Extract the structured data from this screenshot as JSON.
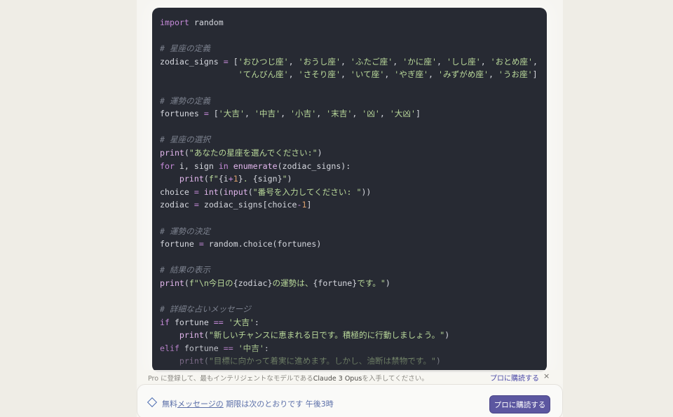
{
  "code_lines": [
    [
      {
        "t": "import",
        "c": "kw"
      },
      {
        "t": " random",
        "c": ""
      }
    ],
    [],
    [
      {
        "t": "# 星座の定義",
        "c": "cmt"
      }
    ],
    [
      {
        "t": "zodiac_signs ",
        "c": ""
      },
      {
        "t": "=",
        "c": "op"
      },
      {
        "t": " [",
        "c": ""
      },
      {
        "t": "'おひつじ座'",
        "c": "str"
      },
      {
        "t": ", ",
        "c": ""
      },
      {
        "t": "'おうし座'",
        "c": "str"
      },
      {
        "t": ", ",
        "c": ""
      },
      {
        "t": "'ふたご座'",
        "c": "str"
      },
      {
        "t": ", ",
        "c": ""
      },
      {
        "t": "'かに座'",
        "c": "str"
      },
      {
        "t": ", ",
        "c": ""
      },
      {
        "t": "'しし座'",
        "c": "str"
      },
      {
        "t": ", ",
        "c": ""
      },
      {
        "t": "'おとめ座'",
        "c": "str"
      },
      {
        "t": ",",
        "c": ""
      }
    ],
    [
      {
        "t": "                ",
        "c": ""
      },
      {
        "t": "'てんびん座'",
        "c": "str"
      },
      {
        "t": ", ",
        "c": ""
      },
      {
        "t": "'さそり座'",
        "c": "str"
      },
      {
        "t": ", ",
        "c": ""
      },
      {
        "t": "'いて座'",
        "c": "str"
      },
      {
        "t": ", ",
        "c": ""
      },
      {
        "t": "'やぎ座'",
        "c": "str"
      },
      {
        "t": ", ",
        "c": ""
      },
      {
        "t": "'みずがめ座'",
        "c": "str"
      },
      {
        "t": ", ",
        "c": ""
      },
      {
        "t": "'うお座'",
        "c": "str"
      },
      {
        "t": "]",
        "c": ""
      }
    ],
    [],
    [
      {
        "t": "# 運勢の定義",
        "c": "cmt"
      }
    ],
    [
      {
        "t": "fortunes ",
        "c": ""
      },
      {
        "t": "=",
        "c": "op"
      },
      {
        "t": " [",
        "c": ""
      },
      {
        "t": "'大吉'",
        "c": "str"
      },
      {
        "t": ", ",
        "c": ""
      },
      {
        "t": "'中吉'",
        "c": "str"
      },
      {
        "t": ", ",
        "c": ""
      },
      {
        "t": "'小吉'",
        "c": "str"
      },
      {
        "t": ", ",
        "c": ""
      },
      {
        "t": "'末吉'",
        "c": "str"
      },
      {
        "t": ", ",
        "c": ""
      },
      {
        "t": "'凶'",
        "c": "str"
      },
      {
        "t": ", ",
        "c": ""
      },
      {
        "t": "'大凶'",
        "c": "str"
      },
      {
        "t": "]",
        "c": ""
      }
    ],
    [],
    [
      {
        "t": "# 星座の選択",
        "c": "cmt"
      }
    ],
    [
      {
        "t": "print",
        "c": "fn"
      },
      {
        "t": "(",
        "c": ""
      },
      {
        "t": "\"あなたの星座を選んでください:\"",
        "c": "str"
      },
      {
        "t": ")",
        "c": ""
      }
    ],
    [
      {
        "t": "for",
        "c": "kw"
      },
      {
        "t": " i, sign ",
        "c": ""
      },
      {
        "t": "in",
        "c": "kw"
      },
      {
        "t": " ",
        "c": ""
      },
      {
        "t": "enumerate",
        "c": "fn"
      },
      {
        "t": "(zodiac_signs):",
        "c": ""
      }
    ],
    [
      {
        "t": "    ",
        "c": ""
      },
      {
        "t": "print",
        "c": "fn"
      },
      {
        "t": "(",
        "c": ""
      },
      {
        "t": "f\"",
        "c": "str"
      },
      {
        "t": "{i",
        "c": ""
      },
      {
        "t": "+",
        "c": "op"
      },
      {
        "t": "1",
        "c": "num"
      },
      {
        "t": "}",
        "c": ""
      },
      {
        "t": ". ",
        "c": "str"
      },
      {
        "t": "{sign}",
        "c": ""
      },
      {
        "t": "\"",
        "c": "str"
      },
      {
        "t": ")",
        "c": ""
      }
    ],
    [
      {
        "t": "choice ",
        "c": ""
      },
      {
        "t": "=",
        "c": "op"
      },
      {
        "t": " ",
        "c": ""
      },
      {
        "t": "int",
        "c": "fn"
      },
      {
        "t": "(",
        "c": ""
      },
      {
        "t": "input",
        "c": "fn"
      },
      {
        "t": "(",
        "c": ""
      },
      {
        "t": "\"番号を入力してください: \"",
        "c": "str"
      },
      {
        "t": "))",
        "c": ""
      }
    ],
    [
      {
        "t": "zodiac ",
        "c": ""
      },
      {
        "t": "=",
        "c": "op"
      },
      {
        "t": " zodiac_signs[choice",
        "c": ""
      },
      {
        "t": "-",
        "c": "op"
      },
      {
        "t": "1",
        "c": "num"
      },
      {
        "t": "]",
        "c": ""
      }
    ],
    [],
    [
      {
        "t": "# 運勢の決定",
        "c": "cmt"
      }
    ],
    [
      {
        "t": "fortune ",
        "c": ""
      },
      {
        "t": "=",
        "c": "op"
      },
      {
        "t": " random.choice(fortunes)",
        "c": ""
      }
    ],
    [],
    [
      {
        "t": "# 結果の表示",
        "c": "cmt"
      }
    ],
    [
      {
        "t": "print",
        "c": "fn"
      },
      {
        "t": "(",
        "c": ""
      },
      {
        "t": "f\"\\n今日の",
        "c": "str"
      },
      {
        "t": "{zodiac}",
        "c": ""
      },
      {
        "t": "の運勢は、",
        "c": "str"
      },
      {
        "t": "{fortune}",
        "c": ""
      },
      {
        "t": "です。\"",
        "c": "str"
      },
      {
        "t": ")",
        "c": ""
      }
    ],
    [],
    [
      {
        "t": "# 詳細な占いメッセージ",
        "c": "cmt"
      }
    ],
    [
      {
        "t": "if",
        "c": "kw"
      },
      {
        "t": " fortune ",
        "c": ""
      },
      {
        "t": "==",
        "c": "op"
      },
      {
        "t": " ",
        "c": ""
      },
      {
        "t": "'大吉'",
        "c": "str"
      },
      {
        "t": ":",
        "c": ""
      }
    ],
    [
      {
        "t": "    ",
        "c": ""
      },
      {
        "t": "print",
        "c": "fn"
      },
      {
        "t": "(",
        "c": ""
      },
      {
        "t": "\"新しいチャンスに恵まれる日です。積極的に行動しましょう。\"",
        "c": "str"
      },
      {
        "t": ")",
        "c": ""
      }
    ],
    [
      {
        "t": "elif",
        "c": "kw"
      },
      {
        "t": " fortune ",
        "c": ""
      },
      {
        "t": "==",
        "c": "op"
      },
      {
        "t": " ",
        "c": ""
      },
      {
        "t": "'中吉'",
        "c": "str"
      },
      {
        "t": ":",
        "c": ""
      }
    ],
    [
      {
        "t": "    ",
        "c": ""
      },
      {
        "t": "print",
        "c": "fn"
      },
      {
        "t": "(",
        "c": ""
      },
      {
        "t": "\"目標に向かって着実に進めます。しかし、油断は禁物です。\"",
        "c": "str"
      },
      {
        "t": ")",
        "c": ""
      }
    ]
  ],
  "pro_banner": {
    "pre": "Pro に登録して、最もインテリジェントなモデルである",
    "model": "Claude 3 Opus",
    "post": "を入手してください。",
    "link": "プロに購読する",
    "close": "×"
  },
  "notice": {
    "free": "無料",
    "messages": "メッセージの",
    "rest": " 期限は次のとおりです 午後3時",
    "button": "プロに購読する"
  },
  "colors": {
    "code_bg": "#272a33",
    "keyword": "#c68ad9",
    "string": "#b9d89a",
    "comment": "#7b808d",
    "button": "#5c57a0",
    "link": "#4b49a8"
  },
  "icons": {
    "notice": "diamond-info-icon",
    "close": "close-icon"
  }
}
